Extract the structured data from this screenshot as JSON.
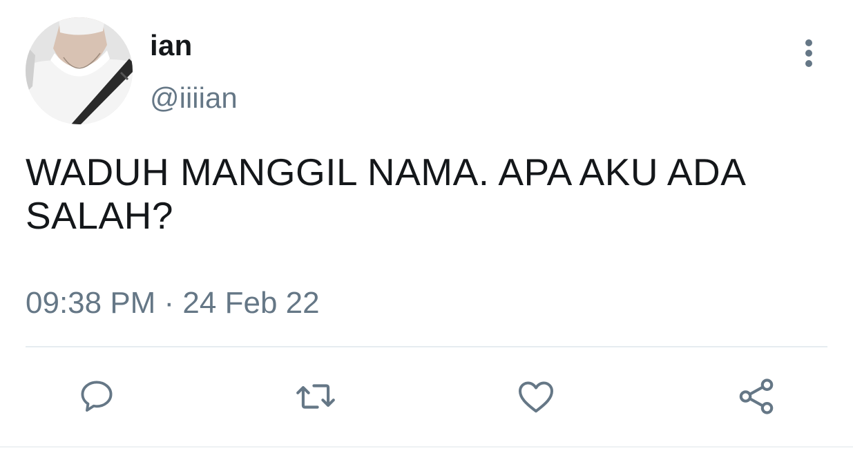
{
  "user": {
    "display_name": "ian",
    "handle": "@iiiian"
  },
  "tweet": {
    "text": "WADUH MANGGIL NAMA. APA AKU ADA SALAH?",
    "timestamp": "09:38 PM · 24 Feb 22"
  },
  "icons": {
    "more": "more-vertical-icon",
    "reply": "reply-icon",
    "retweet": "retweet-icon",
    "like": "heart-icon",
    "share": "share-icon"
  },
  "colors": {
    "text": "#14171a",
    "secondary": "#657786",
    "divider": "#e6ecf0"
  }
}
